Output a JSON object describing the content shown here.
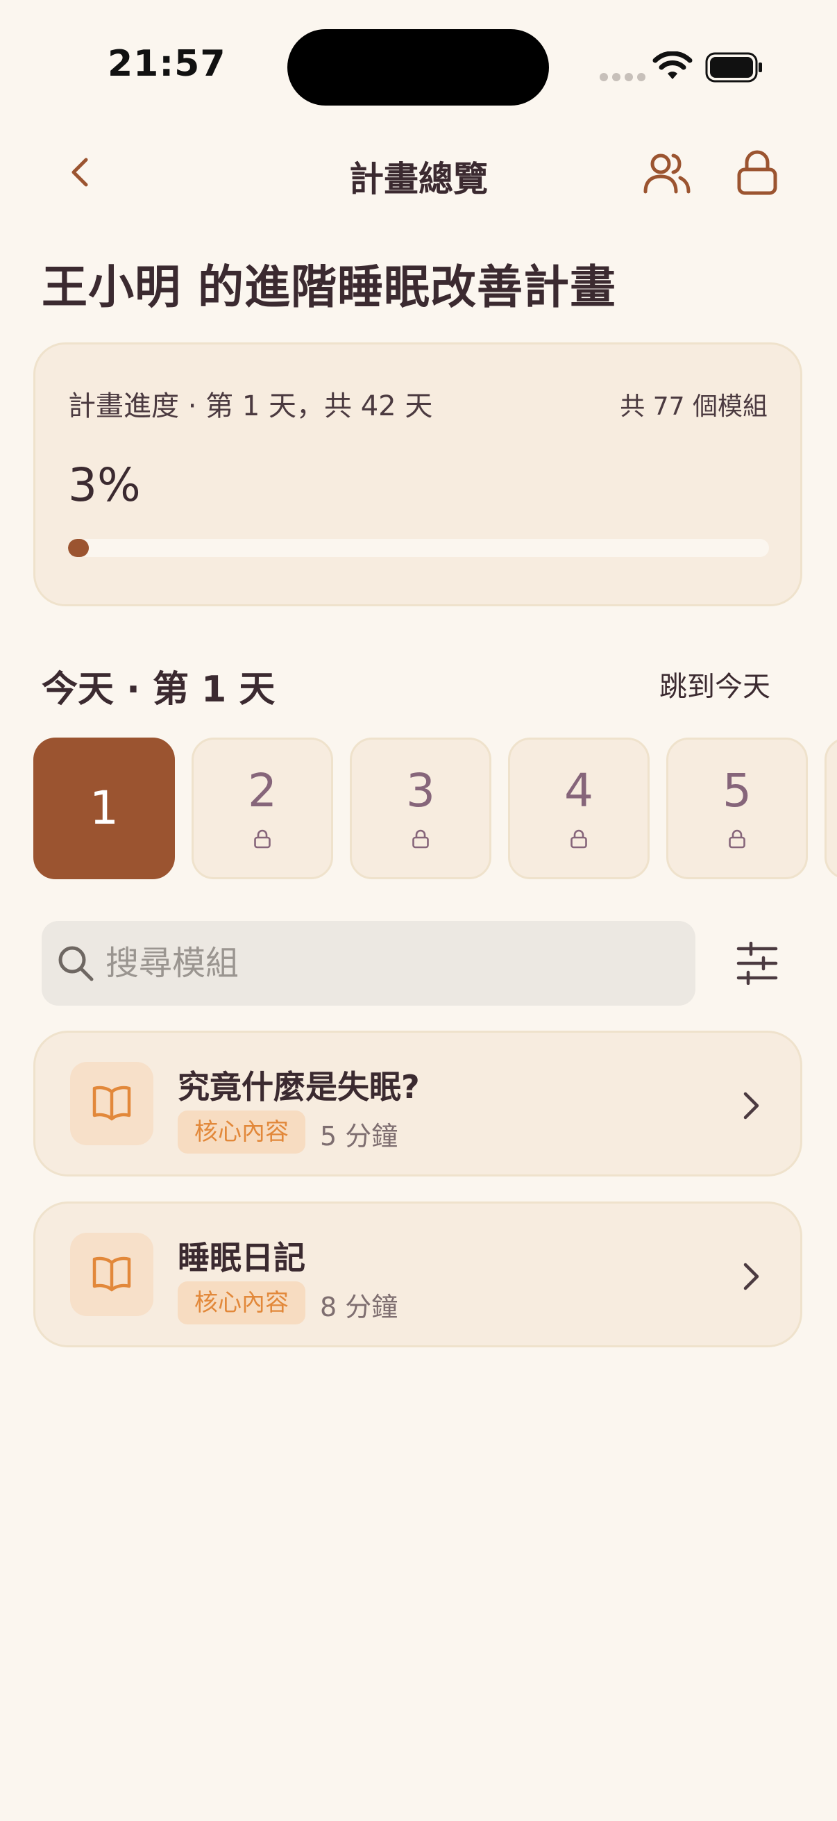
{
  "status_bar": {
    "time": "21:57"
  },
  "nav": {
    "title": "計畫總覽",
    "back_icon": "chevron-left-icon",
    "people_icon": "users-icon",
    "lock_icon": "lock-icon"
  },
  "plan": {
    "title": "王小明 的進階睡眠改善計畫"
  },
  "progress": {
    "label": "計畫進度 · 第 1 天，共 42 天",
    "module_count": "共 77 個模組",
    "percent_text": "3%",
    "percent_value": 0.03
  },
  "today": {
    "label": "今天 · 第 1 天",
    "jump_label": "跳到今天"
  },
  "days": [
    {
      "num": "1",
      "locked": false,
      "active": true
    },
    {
      "num": "2",
      "locked": true,
      "active": false
    },
    {
      "num": "3",
      "locked": true,
      "active": false
    },
    {
      "num": "4",
      "locked": true,
      "active": false
    },
    {
      "num": "5",
      "locked": true,
      "active": false
    },
    {
      "num": "",
      "locked": true,
      "active": false
    }
  ],
  "search": {
    "placeholder": "搜尋模組",
    "value": ""
  },
  "modules": [
    {
      "title": "究竟什麼是失眠?",
      "tag": "核心內容",
      "duration": "5 分鐘",
      "icon": "book-icon"
    },
    {
      "title": "睡眠日記",
      "tag": "核心內容",
      "duration": "8 分鐘",
      "icon": "book-icon"
    }
  ],
  "colors": {
    "accent": "#9b5430",
    "background": "#fbf6ef",
    "card": "#f7ecdf",
    "tag_text": "#e2883a",
    "day_number": "#86657a"
  }
}
